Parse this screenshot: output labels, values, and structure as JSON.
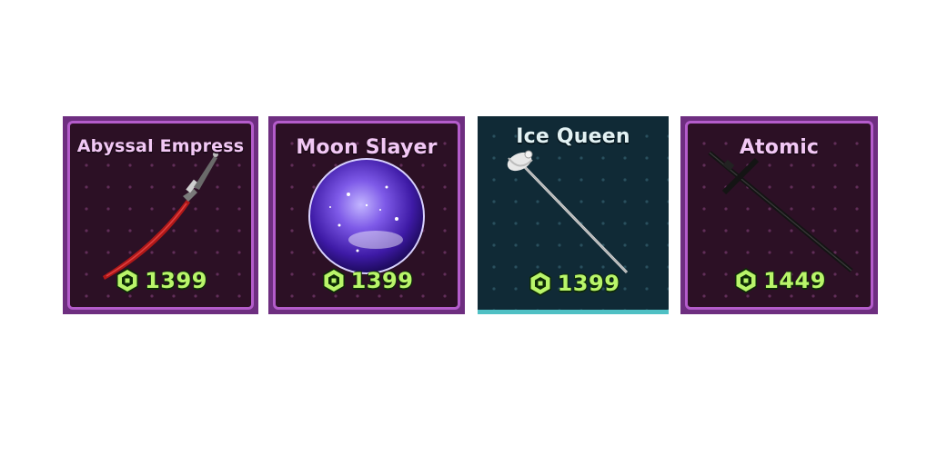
{
  "items": [
    {
      "name": "Abyssal Empress",
      "price": "1399",
      "currency_icon": "robux-icon",
      "art_icon": "red-katana-icon",
      "theme": "#6e2e80"
    },
    {
      "name": "Moon Slayer",
      "price": "1399",
      "currency_icon": "robux-icon",
      "art_icon": "purple-orb-icon",
      "theme": "#6e2e80"
    },
    {
      "name": "Ice Queen",
      "price": "1399",
      "currency_icon": "robux-icon",
      "art_icon": "rapier-icon",
      "theme": "#102a36"
    },
    {
      "name": "Atomic",
      "price": "1449",
      "currency_icon": "robux-icon",
      "art_icon": "black-sword-icon",
      "theme": "#6e2e80"
    }
  ],
  "colors": {
    "price_text": "#b9f56a",
    "purple_border": "#b45ccb",
    "ice_accent": "#4fc0c4"
  }
}
